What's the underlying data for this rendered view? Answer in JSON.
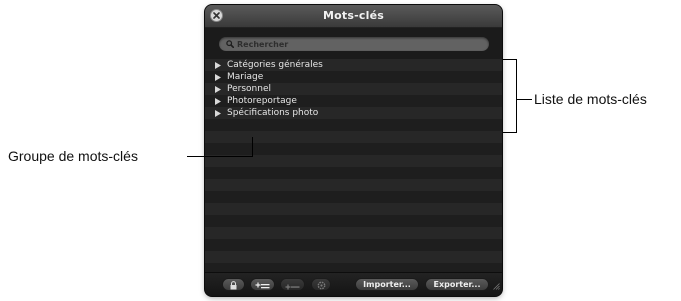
{
  "window": {
    "title": "Mots-clés"
  },
  "search": {
    "placeholder": "Rechercher"
  },
  "keyword_groups": [
    "Catégories générales",
    "Mariage",
    "Personnel",
    "Photoreportage",
    "Spécifications photo"
  ],
  "toolbar": {
    "import_label": "Importer...",
    "export_label": "Exporter..."
  },
  "icons": {
    "close": "close-icon",
    "search": "search-icon",
    "disclosure": "disclosure-triangle-icon",
    "lock": "lock-icon",
    "add_group": "add-group-icon",
    "add_keyword": "add-keyword-icon",
    "action": "gear-icon",
    "resize": "resize-grip-icon"
  },
  "callouts": {
    "list": "Liste de mots-clés",
    "group": "Groupe de mots-clés"
  }
}
